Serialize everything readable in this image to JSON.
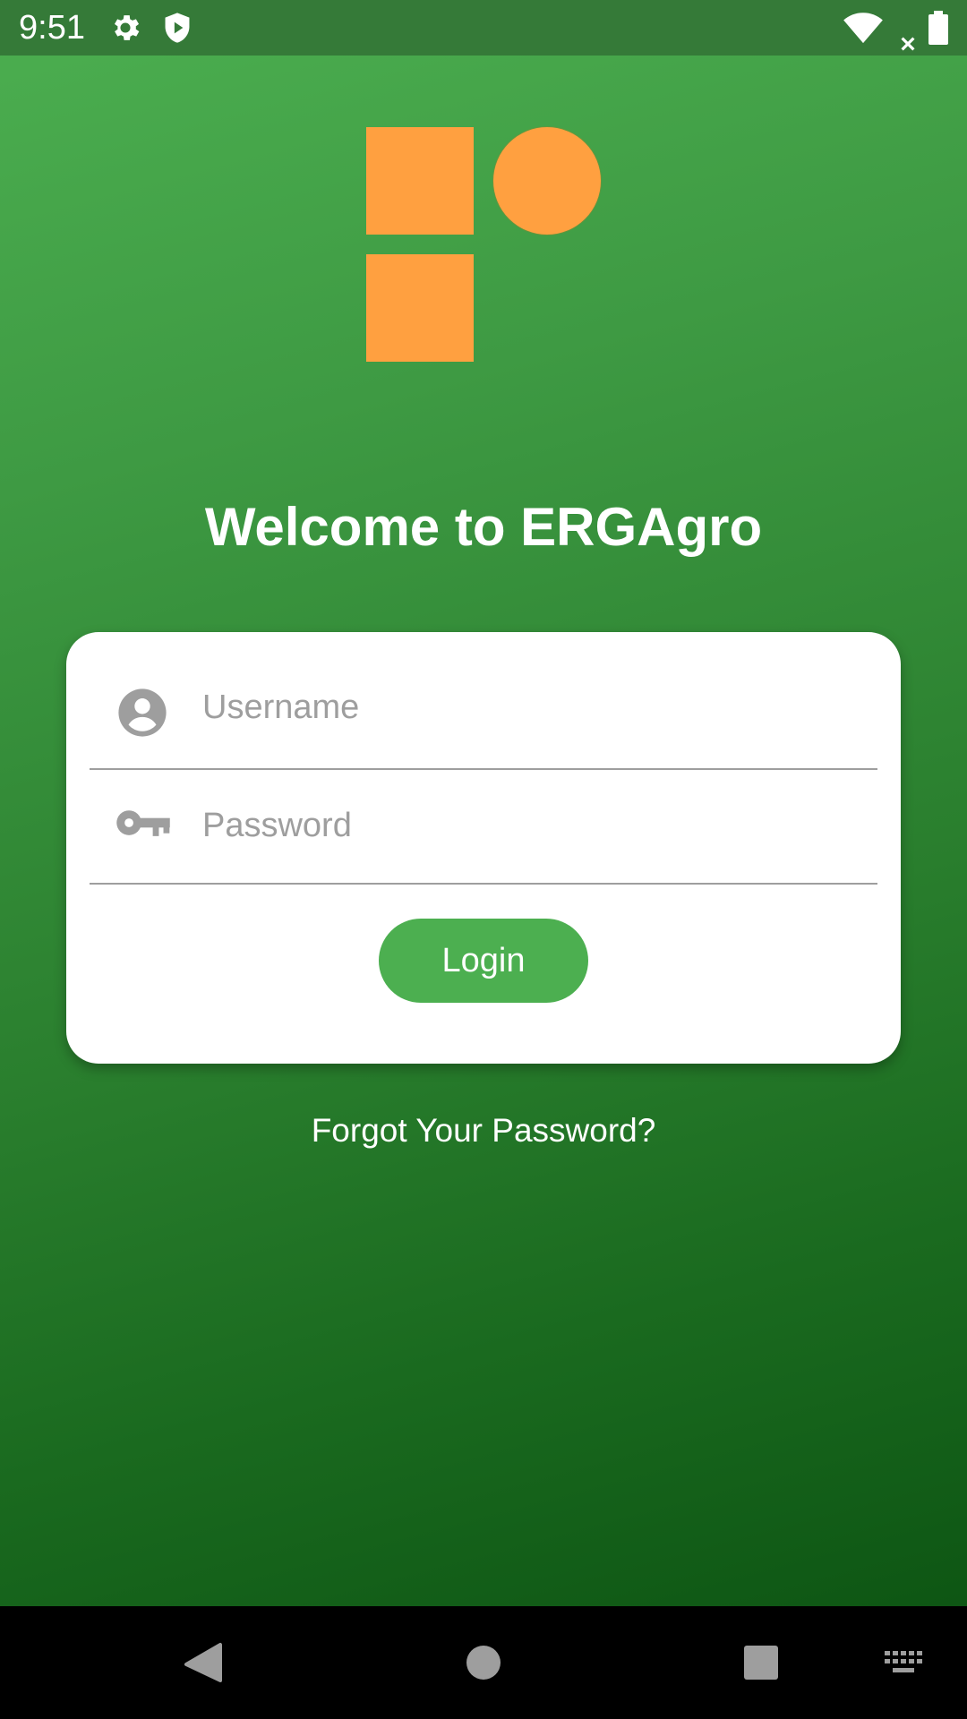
{
  "status_bar": {
    "time": "9:51",
    "icons": [
      "settings-icon",
      "shield-play-icon",
      "wifi-icon",
      "no-signal-icon",
      "battery-icon"
    ]
  },
  "app": {
    "logo": "ergagro-logo",
    "welcome_title": "Welcome to ERGAgro",
    "brand_color": "#4caf50",
    "logo_color": "#ffa040"
  },
  "login_form": {
    "username": {
      "icon": "account-circle-icon",
      "placeholder": "Username",
      "value": ""
    },
    "password": {
      "icon": "key-icon",
      "placeholder": "Password",
      "value": ""
    },
    "login_label": "Login",
    "forgot_label": "Forgot Your Password?"
  },
  "nav_bar": {
    "buttons": [
      "back-icon",
      "home-icon",
      "recents-icon",
      "keyboard-icon"
    ]
  }
}
